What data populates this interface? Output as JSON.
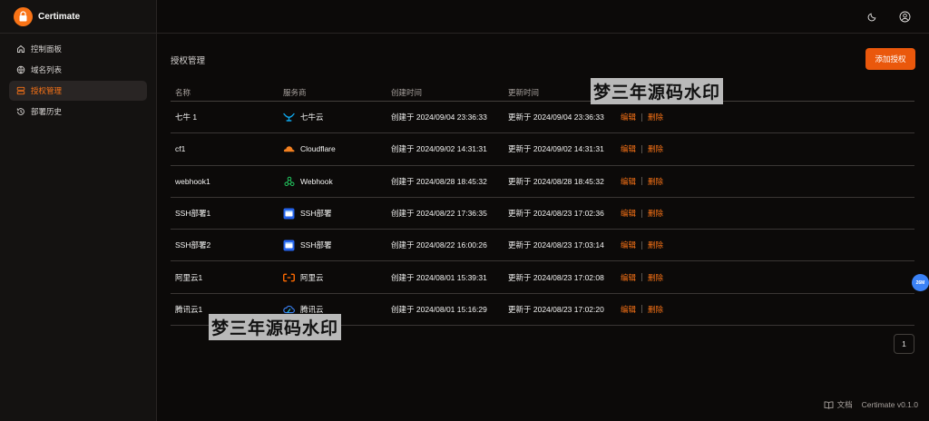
{
  "app": {
    "name": "Certimate",
    "version": "Certimate v0.1.0"
  },
  "sidebar": {
    "items": [
      {
        "label": "控制面板",
        "icon": "home-icon"
      },
      {
        "label": "域名列表",
        "icon": "globe-icon"
      },
      {
        "label": "授权管理",
        "icon": "server-icon",
        "active": true
      },
      {
        "label": "部署历史",
        "icon": "history-icon"
      }
    ]
  },
  "main": {
    "title": "授权管理",
    "add_label": "添加授权",
    "columns": [
      "名称",
      "服务商",
      "创建时间",
      "更新时间"
    ],
    "rows": [
      {
        "name": "七牛 1",
        "provider": "七牛云",
        "provider_icon": "qiniu-icon",
        "created": "创建于 2024/09/04 23:36:33",
        "updated": "更新于 2024/09/04 23:36:33"
      },
      {
        "name": "cf1",
        "provider": "Cloudflare",
        "provider_icon": "cloudflare-icon",
        "created": "创建于 2024/09/02 14:31:31",
        "updated": "更新于 2024/09/02 14:31:31"
      },
      {
        "name": "webhook1",
        "provider": "Webhook",
        "provider_icon": "webhook-icon",
        "created": "创建于 2024/08/28 18:45:32",
        "updated": "更新于 2024/08/28 18:45:32"
      },
      {
        "name": "SSH部署1",
        "provider": "SSH部署",
        "provider_icon": "ssh-icon",
        "created": "创建于 2024/08/22 17:36:35",
        "updated": "更新于 2024/08/23 17:02:36"
      },
      {
        "name": "SSH部署2",
        "provider": "SSH部署",
        "provider_icon": "ssh-icon",
        "created": "创建于 2024/08/22 16:00:26",
        "updated": "更新于 2024/08/23 17:03:14"
      },
      {
        "name": "阿里云1",
        "provider": "阿里云",
        "provider_icon": "aliyun-icon",
        "created": "创建于 2024/08/01 15:39:31",
        "updated": "更新于 2024/08/23 17:02:08"
      },
      {
        "name": "腾讯云1",
        "provider": "腾讯云",
        "provider_icon": "tencent-cloud-icon",
        "created": "创建于 2024/08/01 15:16:29",
        "updated": "更新于 2024/08/23 17:02:20"
      }
    ],
    "edit_label": "编辑",
    "delete_label": "删除",
    "page": "1"
  },
  "footer": {
    "docs_label": "文档"
  },
  "watermark": "梦三年源码水印",
  "float_badge": "26M",
  "colors": {
    "accent": "#f97316",
    "background": "#0c0a09"
  }
}
